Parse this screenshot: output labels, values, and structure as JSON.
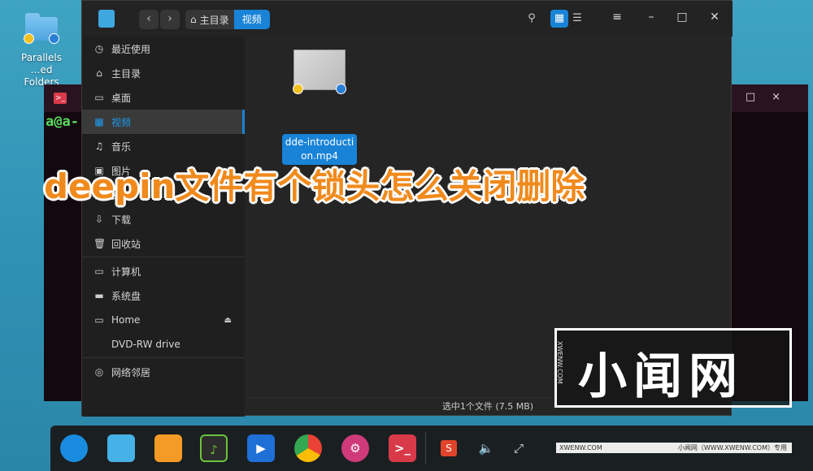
{
  "desktop": {
    "icon_label_line1": "Parallels",
    "icon_label_line2": "…ed Folders"
  },
  "terminal": {
    "prompt": "a@a-"
  },
  "file_manager": {
    "breadcrumb": {
      "home": "主目录",
      "current": "视频"
    },
    "sidebar": {
      "items": [
        {
          "label": "最近使用",
          "icon": "clock-icon"
        },
        {
          "label": "主目录",
          "icon": "home-icon"
        },
        {
          "label": "桌面",
          "icon": "desktop-icon"
        },
        {
          "label": "视频",
          "icon": "video-icon"
        },
        {
          "label": "音乐",
          "icon": "music-icon"
        },
        {
          "label": "图片",
          "icon": "picture-icon"
        },
        {
          "label": "文档",
          "icon": "document-icon"
        },
        {
          "label": "下载",
          "icon": "download-icon"
        },
        {
          "label": "回收站",
          "icon": "trash-icon"
        },
        {
          "label": "计算机",
          "icon": "computer-icon"
        },
        {
          "label": "系统盘",
          "icon": "disk-icon"
        },
        {
          "label": "Home",
          "icon": "drive-icon"
        },
        {
          "label": "DVD-RW drive",
          "icon": ""
        },
        {
          "label": "网络邻居",
          "icon": "network-icon"
        }
      ]
    },
    "file": {
      "name": "dde-introduction.mp4"
    },
    "status": "选中1个文件 (7.5 MB)",
    "accent_color": "#1883d7"
  },
  "overlay_title": "deepin文件有个锁头怎么关闭删除",
  "watermark": {
    "title": "小闻网",
    "side_text": "XWENW.COM",
    "footer_left": "XWENW.COM",
    "footer_right": "小闻网（WWW.XWENW.COM）专用"
  }
}
